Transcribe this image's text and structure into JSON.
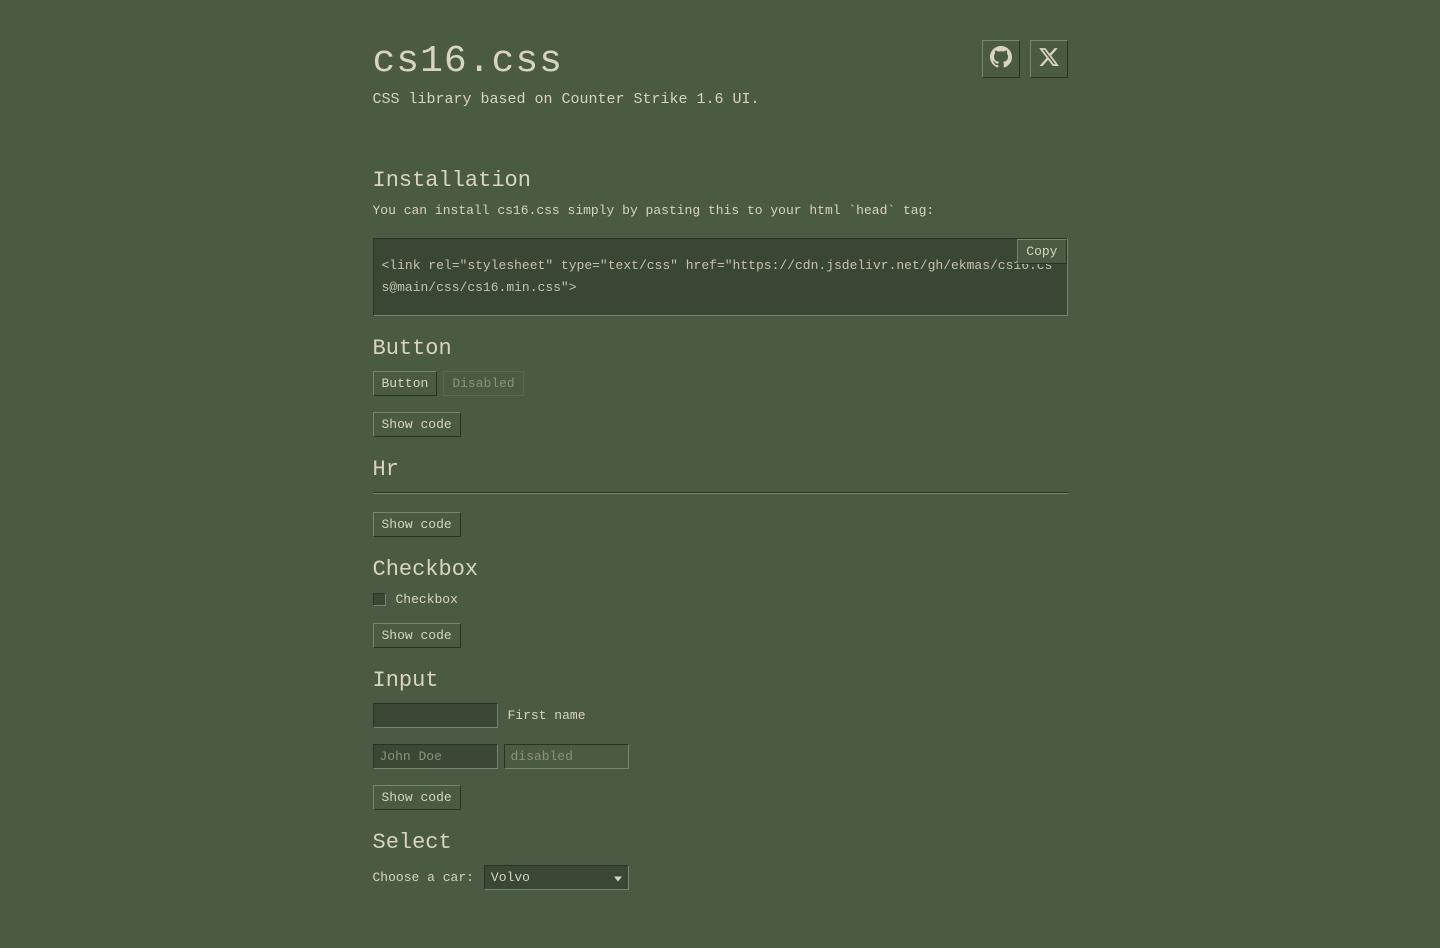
{
  "header": {
    "title": "cs16.css",
    "subtitle": "CSS library based on Counter Strike 1.6 UI."
  },
  "installation": {
    "heading": "Installation",
    "text": "You can install cs16.css simply by pasting this to your html `head` tag:",
    "code": "<link rel=\"stylesheet\" type=\"text/css\" href=\"https://cdn.jsdelivr.net/gh/ekmas/cs16.css@main/css/cs16.min.css\">",
    "copy_label": "Copy"
  },
  "button_section": {
    "heading": "Button",
    "button_label": "Button",
    "disabled_label": "Disabled",
    "show_code_label": "Show code"
  },
  "hr_section": {
    "heading": "Hr",
    "show_code_label": "Show code"
  },
  "checkbox_section": {
    "heading": "Checkbox",
    "label": "Checkbox",
    "show_code_label": "Show code"
  },
  "input_section": {
    "heading": "Input",
    "first_name_label": "First name",
    "placeholder": "John Doe",
    "disabled_placeholder": "disabled",
    "show_code_label": "Show code"
  },
  "select_section": {
    "heading": "Select",
    "label": "Choose a car:",
    "selected": "Volvo"
  }
}
